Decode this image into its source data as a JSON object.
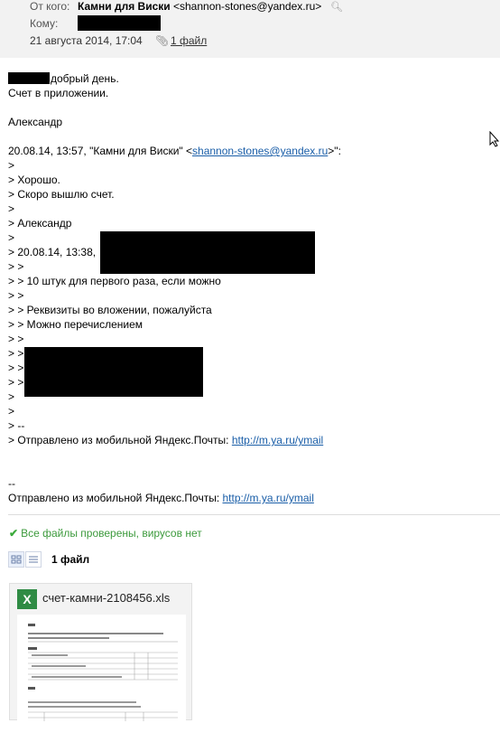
{
  "header": {
    "from_label": "От кого:",
    "from_name": "Камни для Виски",
    "from_email": "<shannon-stones@yandex.ru>",
    "to_label": "Кому:",
    "date": "21 августа 2014, 17:04",
    "attachments_link": "1 файл"
  },
  "body": {
    "greeting": "добрый день.",
    "line2": "Счет в приложении.",
    "signature": "Александр",
    "quote_header_prefix": "20.08.14, 13:57, \"Камни для Виски\" <",
    "quote_header_email": "shannon-stones@yandex.ru",
    "quote_header_suffix": ">\":",
    "q1": ">",
    "q2": "> Хорошо.",
    "q3": "> Скоро вышлю счет.",
    "q4": ">",
    "q5": "> Александр",
    "q6": ">",
    "q7": "> 20.08.14, 13:38,",
    "q8": "> >",
    "q9": "> > 10 штук для первого раза, если можно",
    "q10": "> >",
    "q11": "> > Реквизиты во вложении, пожалуйста",
    "q12": "> > Можно перечислением",
    "q13": "> >",
    "q14": "> >",
    "q15": "> >",
    "q16": "> >",
    "q17": ">",
    "q18": ">",
    "q19": "> --",
    "q20_prefix": "> Отправлено из мобильной Яндекс.Почты:",
    "q20_link": "http://m.ya.ru/ymail",
    "sig_dash": "--",
    "sig_prefix": "Отправлено из мобильной Яндекс.Почты:",
    "sig_link": "http://m.ya.ru/ymail"
  },
  "attachments": {
    "virus_status": "Все файлы проверены, вирусов нет",
    "count_label": "1 файл",
    "file_name": "счет-камни-2108456.xls",
    "file_badge": "X"
  },
  "colors": {
    "link": "#1a5ea8",
    "ok": "#3c9a3c",
    "excel": "#2f8b44"
  }
}
